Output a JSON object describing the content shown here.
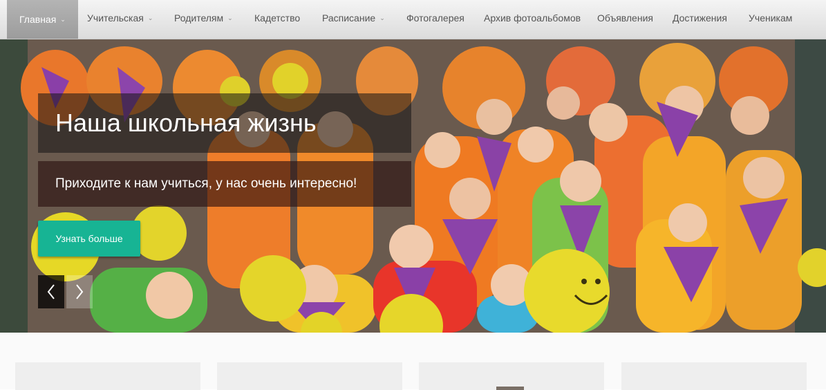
{
  "nav": {
    "items": [
      {
        "label": "Главная",
        "has_dropdown": true,
        "active": true
      },
      {
        "label": "Учительская",
        "has_dropdown": true
      },
      {
        "label": "Родителям",
        "has_dropdown": true
      },
      {
        "label": "Кадетство",
        "has_dropdown": false
      },
      {
        "label": "Расписание",
        "has_dropdown": true
      },
      {
        "label": "Фотогалерея",
        "has_dropdown": false
      },
      {
        "label": "Архив фотоальбомов",
        "has_dropdown": false
      },
      {
        "label": "Объявления",
        "has_dropdown": false
      },
      {
        "label": "Достижения",
        "has_dropdown": false
      },
      {
        "label": "Ученикам",
        "has_dropdown": false
      }
    ]
  },
  "hero": {
    "title": "Наша школьная жизнь",
    "subtitle": "Приходите к нам учиться, у нас очень интересно!",
    "cta_label": "Узнать больше",
    "prev_icon": "chevron-left-icon",
    "next_icon": "chevron-right-icon"
  },
  "colors": {
    "accent": "#17b494",
    "nav_active": "#a8a8a8"
  }
}
